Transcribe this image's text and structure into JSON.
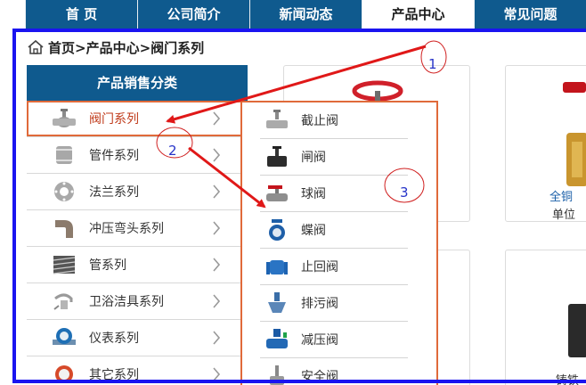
{
  "nav": {
    "items": [
      "首 页",
      "公司简介",
      "新闻动态",
      "产品中心",
      "常见问题"
    ],
    "active_index": 3
  },
  "breadcrumb": {
    "text": "首页>产品中心>阀门系列"
  },
  "sidebar": {
    "title": "产品销售分类",
    "items": [
      {
        "label": "阀门系列",
        "icon": "valve-icon"
      },
      {
        "label": "管件系列",
        "icon": "pipe-fitting-icon"
      },
      {
        "label": "法兰系列",
        "icon": "flange-icon"
      },
      {
        "label": "冲压弯头系列",
        "icon": "elbow-icon"
      },
      {
        "label": "管系列",
        "icon": "pipes-icon"
      },
      {
        "label": "卫浴洁具系列",
        "icon": "faucet-icon"
      },
      {
        "label": "仪表系列",
        "icon": "meter-icon"
      },
      {
        "label": "其它系列",
        "icon": "other-icon"
      }
    ],
    "active_index": 0
  },
  "submenu": {
    "items": [
      {
        "label": "截止阀",
        "icon": "globe-valve-icon"
      },
      {
        "label": "闸阀",
        "icon": "gate-valve-icon"
      },
      {
        "label": "球阀",
        "icon": "ball-valve-icon"
      },
      {
        "label": "蝶阀",
        "icon": "butterfly-valve-icon"
      },
      {
        "label": "止回阀",
        "icon": "check-valve-icon"
      },
      {
        "label": "排污阀",
        "icon": "drain-valve-icon"
      },
      {
        "label": "减压阀",
        "icon": "pressure-reducing-valve-icon"
      },
      {
        "label": "安全阀",
        "icon": "safety-valve-icon"
      }
    ]
  },
  "product_cards": {
    "right_card_title": "全铜",
    "right_card_unit": "单位",
    "bottom_right_text": "铸铁"
  },
  "annotations": {
    "labels": [
      "1",
      "2",
      "3"
    ]
  },
  "colors": {
    "nav_blue": "#0f5a8e",
    "frame_blue": "#1a14f0",
    "accent_orange": "#e06a3a",
    "arrow_red": "#e01818",
    "active_text": "#c03a1a",
    "annotation_text": "#2633c8"
  }
}
